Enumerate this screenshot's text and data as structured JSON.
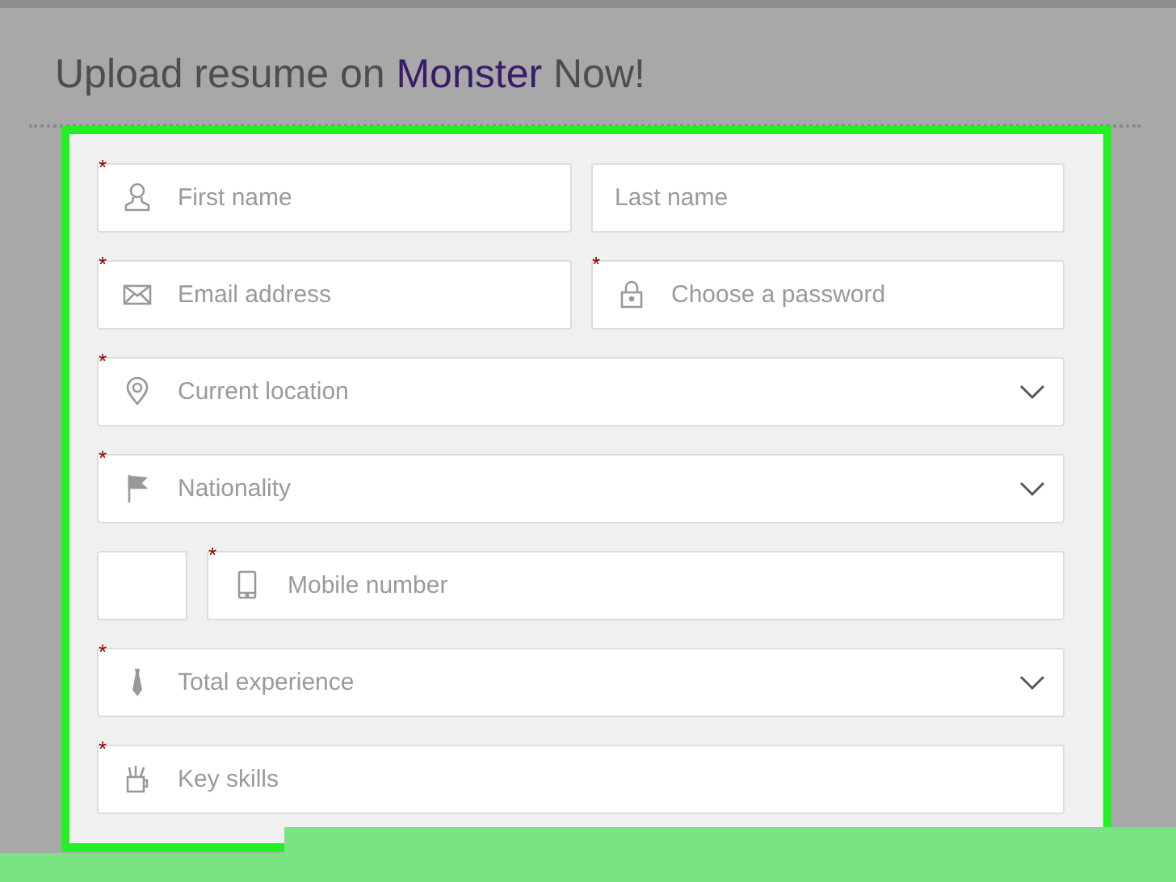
{
  "heading": {
    "before": "Upload resume on",
    "brand": "Monster",
    "after": "Now!"
  },
  "form_rows": [
    [
      {
        "kind": "text",
        "marker": "*",
        "placeholder": "First name"
      },
      {
        "kind": "text",
        "placeholder": "Last name"
      }
    ],
    [
      {
        "kind": "text",
        "marker": "*",
        "placeholder": "Email address"
      },
      {
        "kind": "text",
        "marker": "*",
        "placeholder": "Choose a password"
      }
    ],
    [
      {
        "kind": "select",
        "marker": "*",
        "placeholder": "Current location"
      }
    ],
    [
      {
        "kind": "select",
        "marker": "*",
        "placeholder": "Nationality"
      }
    ],
    [
      {
        "kind": "code"
      },
      {
        "kind": "text",
        "marker": "*",
        "placeholder": "Mobile number"
      }
    ],
    [
      {
        "kind": "select",
        "marker": "*",
        "placeholder": "Total experience"
      }
    ],
    [
      {
        "kind": "text",
        "marker": "*",
        "placeholder": "Key skills"
      }
    ]
  ]
}
